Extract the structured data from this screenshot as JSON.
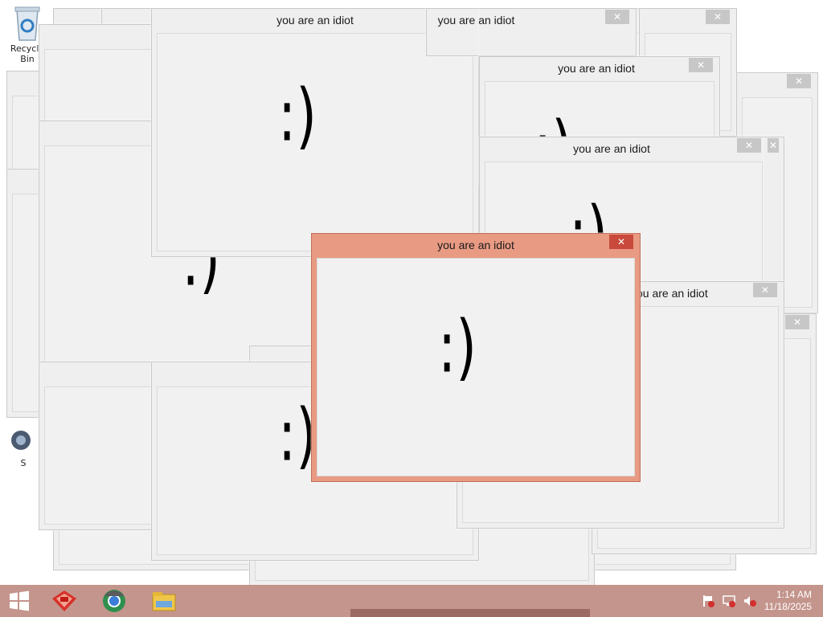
{
  "desktop": {
    "icons": [
      {
        "label": "Recycle Bin",
        "icon": "recycle-bin-icon"
      },
      {
        "label": "S",
        "icon": "shortcut-icon"
      }
    ]
  },
  "window_title": "you are an idiot",
  "smile": ":)",
  "close_glyph": "✕",
  "taskbar": {
    "start_icon": "windows-start-icon",
    "pinned": [
      {
        "icon": "firewall-app-icon"
      },
      {
        "icon": "browser-icon"
      },
      {
        "icon": "file-explorer-icon"
      }
    ],
    "clock": {
      "time": "1:14 AM",
      "date": "11/18/2025"
    }
  },
  "colors": {
    "active_frame": "#e89a83",
    "active_close": "#c94a3c",
    "taskbar": "#c4958c"
  }
}
